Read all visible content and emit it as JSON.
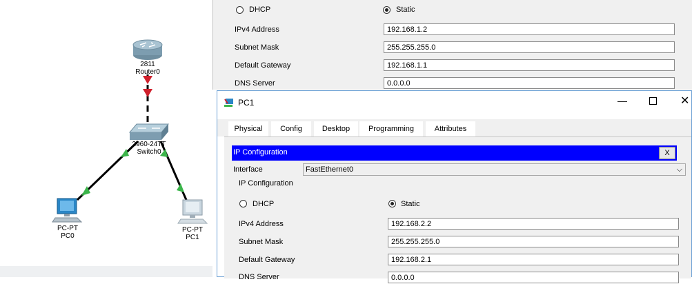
{
  "topology": {
    "router": {
      "model": "2811",
      "name": "Router0"
    },
    "switch": {
      "model": "2960-24TT",
      "name": "Switch0"
    },
    "pc0": {
      "model": "PC-PT",
      "name": "PC0"
    },
    "pc1": {
      "model": "PC-PT",
      "name": "PC1"
    },
    "colors": {
      "link": "#000000",
      "up": "#3bb54a",
      "down": "#d0202c"
    }
  },
  "pc0_window": {
    "dhcp_label": "DHCP",
    "static_label": "Static",
    "mode": "static",
    "ipv4_label": "IPv4 Address",
    "ipv4_value": "192.168.1.2",
    "mask_label": "Subnet Mask",
    "mask_value": "255.255.255.0",
    "gateway_label": "Default Gateway",
    "gateway_value": "192.168.1.1",
    "dns_label": "DNS Server",
    "dns_value": "0.0.0.0"
  },
  "pc1_window": {
    "title": "PC1",
    "tabs": [
      "Physical",
      "Config",
      "Desktop",
      "Programming",
      "Attributes"
    ],
    "active_tab": "Desktop",
    "ip_config_header": "IP Configuration",
    "close_label": "X",
    "interface_label": "Interface",
    "interface_value": "FastEthernet0",
    "section_label": "IP Configuration",
    "dhcp_label": "DHCP",
    "static_label": "Static",
    "mode": "static",
    "ipv4_label": "IPv4 Address",
    "ipv4_value": "192.168.2.2",
    "mask_label": "Subnet Mask",
    "mask_value": "255.255.255.0",
    "gateway_label": "Default Gateway",
    "gateway_value": "192.168.2.1",
    "dns_label": "DNS Server",
    "dns_value": "0.0.0.0",
    "accent": "#0000ff"
  }
}
